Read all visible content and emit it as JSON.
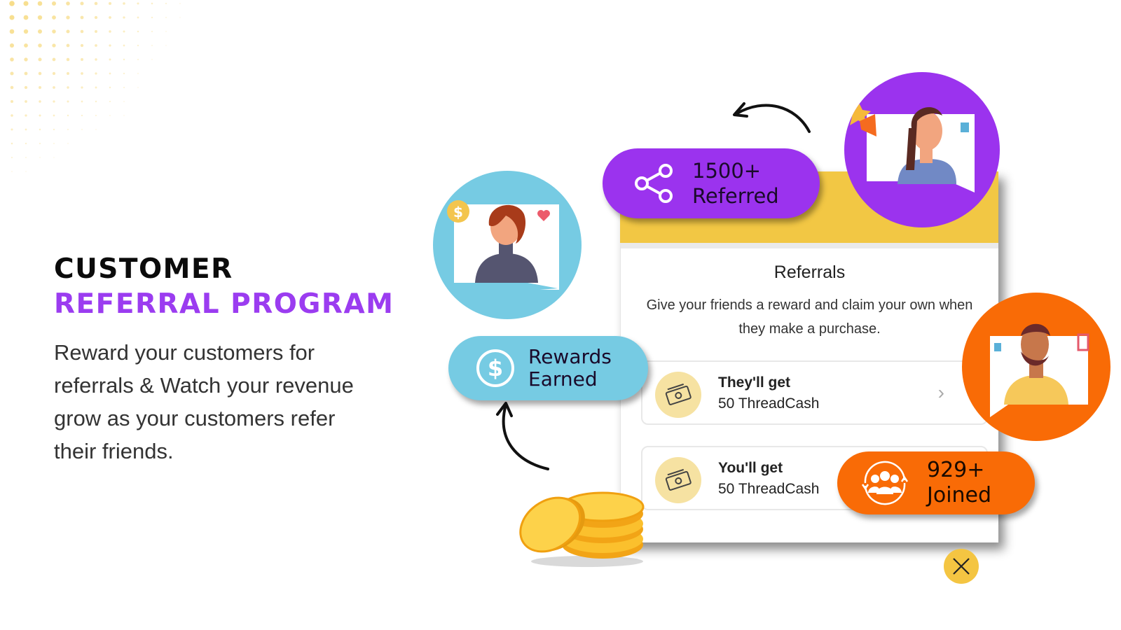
{
  "hero": {
    "title_line1": "CUSTOMER",
    "title_line2": "REFERRAL PROGRAM",
    "description": "Reward your customers for referrals & Watch your revenue grow as your customers refer their friends."
  },
  "colors": {
    "accent_purple": "#9b33ee",
    "accent_blue": "#76cbe3",
    "accent_orange": "#f96b06",
    "accent_yellow": "#f2c744"
  },
  "stats": {
    "referred": {
      "count": "1500+",
      "label": "Referred",
      "icon": "share-icon"
    },
    "rewards": {
      "line1": "Rewards",
      "line2": "Earned",
      "icon": "dollar-circle-icon"
    },
    "joined": {
      "count": "929+",
      "label": "Joined",
      "icon": "group-icon"
    }
  },
  "referral_card": {
    "title": "Referrals",
    "description": "Give your friends a reward and claim your own when they make a purchase.",
    "rewards": [
      {
        "label": "They'll get",
        "value": "50 ThreadCash",
        "icon": "money-icon"
      },
      {
        "label": "You'll get",
        "value": "50 ThreadCash",
        "icon": "money-icon"
      }
    ],
    "close_icon": "close-icon"
  }
}
